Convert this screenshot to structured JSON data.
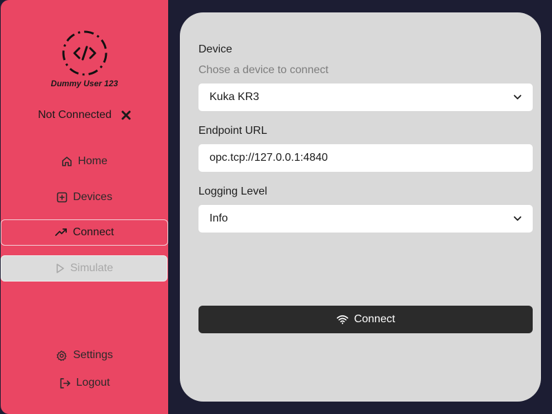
{
  "sidebar": {
    "user_name": "Dummy User 123",
    "status_text": "Not Connected",
    "nav": [
      {
        "label": "Home",
        "icon": "home-icon"
      },
      {
        "label": "Devices",
        "icon": "plus-square-icon"
      },
      {
        "label": "Connect",
        "icon": "trending-up-icon",
        "state": "active"
      },
      {
        "label": "Simulate",
        "icon": "play-icon",
        "state": "disabled"
      }
    ],
    "settings_label": "Settings",
    "logout_label": "Logout"
  },
  "form": {
    "device_label": "Device",
    "device_hint": "Chose a device to connect",
    "device_value": "Kuka KR3",
    "endpoint_label": "Endpoint URL",
    "endpoint_value": "opc.tcp://127.0.0.1:4840",
    "logging_label": "Logging Level",
    "logging_value": "Info",
    "connect_label": "Connect"
  },
  "colors": {
    "sidebar_bg": "#ea4663",
    "page_bg": "#1c1d33",
    "panel_bg": "#d9d9d9",
    "button_bg": "#2b2b2b"
  }
}
